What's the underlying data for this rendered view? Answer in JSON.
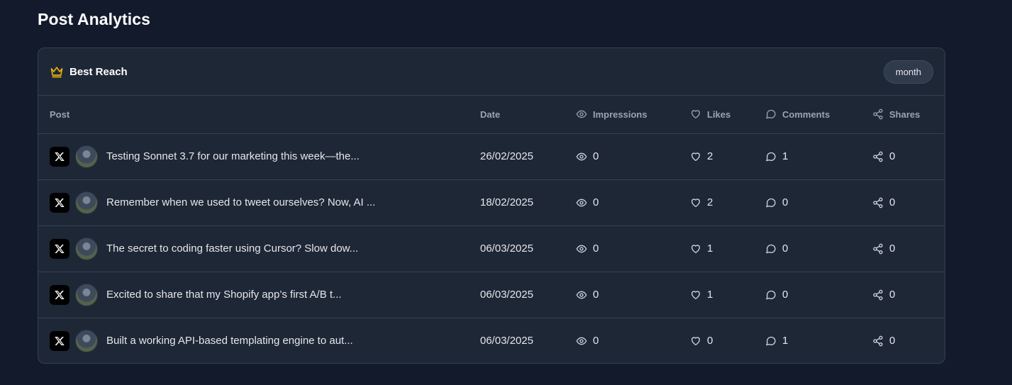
{
  "page": {
    "title": "Post Analytics"
  },
  "card": {
    "title": "Best Reach",
    "period_button": "month"
  },
  "table": {
    "headers": {
      "post": "Post",
      "date": "Date",
      "impressions": "Impressions",
      "likes": "Likes",
      "comments": "Comments",
      "shares": "Shares"
    },
    "rows": [
      {
        "text": "Testing Sonnet 3.7 for our marketing this week—the...",
        "date": "26/02/2025",
        "impressions": "0",
        "likes": "2",
        "comments": "1",
        "shares": "0"
      },
      {
        "text": "Remember when we used to tweet ourselves? Now, AI ...",
        "date": "18/02/2025",
        "impressions": "0",
        "likes": "2",
        "comments": "0",
        "shares": "0"
      },
      {
        "text": "The secret to coding faster using Cursor? Slow dow...",
        "date": "06/03/2025",
        "impressions": "0",
        "likes": "1",
        "comments": "0",
        "shares": "0"
      },
      {
        "text": "Excited to share that my Shopify app’s first A/B t...",
        "date": "06/03/2025",
        "impressions": "0",
        "likes": "1",
        "comments": "0",
        "shares": "0"
      },
      {
        "text": "Built a working API-based templating engine to aut...",
        "date": "06/03/2025",
        "impressions": "0",
        "likes": "0",
        "comments": "1",
        "shares": "0"
      }
    ]
  },
  "colors": {
    "background": "#121a2b",
    "card": "#1e2736",
    "border": "#334052",
    "accent_crown": "#eab308"
  },
  "icons": {
    "crown": "crown-icon",
    "platform": "x-logo-icon",
    "impressions": "eye-icon",
    "likes": "heart-icon",
    "comments": "comment-icon",
    "shares": "share-icon"
  }
}
